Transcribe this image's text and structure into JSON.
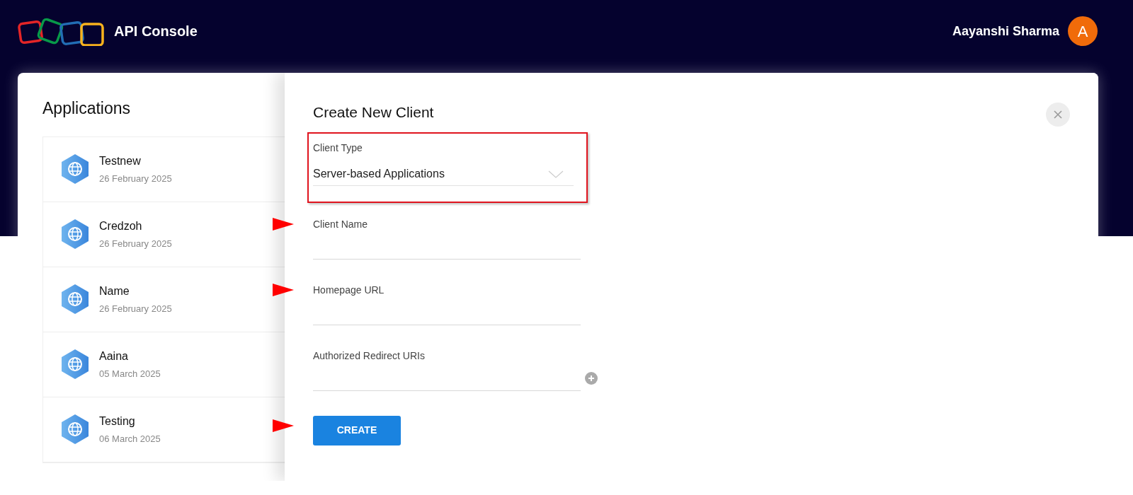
{
  "header": {
    "product": "API Console",
    "user_name": "Aayanshi Sharma",
    "avatar_initial": "A"
  },
  "applications": {
    "title": "Applications",
    "items": [
      {
        "name": "Testnew",
        "date": "26 February 2025"
      },
      {
        "name": "Credzoh",
        "date": "26 February 2025"
      },
      {
        "name": "Name",
        "date": "26 February 2025"
      },
      {
        "name": "Aaina",
        "date": "05 March 2025"
      },
      {
        "name": "Testing",
        "date": "06 March 2025"
      }
    ]
  },
  "dialog": {
    "title": "Create New Client",
    "fields": [
      {
        "kind": "select",
        "label": "Client Type",
        "value": "Server-based Applications",
        "highlighted": true
      },
      {
        "kind": "text",
        "label": "Client Name",
        "arrow": true
      },
      {
        "kind": "text",
        "label": "Homepage URL",
        "arrow": true
      },
      {
        "kind": "multi",
        "label": "Authorized Redirect URIs"
      }
    ],
    "submit": {
      "label": "CREATE",
      "arrow": true
    }
  }
}
